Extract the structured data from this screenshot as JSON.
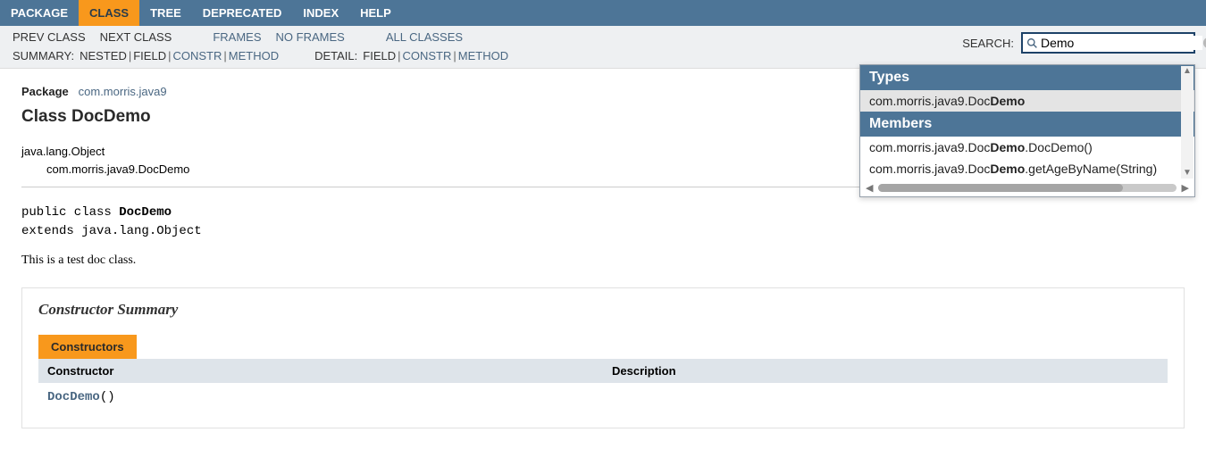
{
  "topNav": {
    "items": [
      {
        "label": "PACKAGE"
      },
      {
        "label": "CLASS"
      },
      {
        "label": "TREE"
      },
      {
        "label": "DEPRECATED"
      },
      {
        "label": "INDEX"
      },
      {
        "label": "HELP"
      }
    ],
    "activeIndex": 1
  },
  "subNav": {
    "prev": "PREV CLASS",
    "next": "NEXT CLASS",
    "frames": "FRAMES",
    "noFrames": "NO FRAMES",
    "allClasses": "ALL CLASSES",
    "summaryLabel": "SUMMARY:",
    "summary": {
      "nested": "NESTED",
      "field": "FIELD",
      "constr": "CONSTR",
      "method": "METHOD"
    },
    "detailLabel": "DETAIL:",
    "detail": {
      "field": "FIELD",
      "constr": "CONSTR",
      "method": "METHOD"
    }
  },
  "search": {
    "label": "SEARCH:",
    "value": "Demo",
    "placeholder": ""
  },
  "dropdown": {
    "typesHeader": "Types",
    "typeItem": {
      "prefix": "com.morris.java9.Doc",
      "bold": "Demo"
    },
    "membersHeader": "Members",
    "memberItems": [
      {
        "prefix": "com.morris.java9.Doc",
        "bold": "Demo",
        "suffix": ".DocDemo()"
      },
      {
        "prefix": "com.morris.java9.Doc",
        "bold": "Demo",
        "suffix": ".getAgeByName(String)"
      }
    ]
  },
  "page": {
    "packageLabel": "Package",
    "packageLink": "com.morris.java9",
    "classTitle": "Class DocDemo",
    "inherit1": "java.lang.Object",
    "inherit2": "com.morris.java9.DocDemo",
    "sigLine1Prefix": "public class ",
    "sigLine1Class": "DocDemo",
    "sigLine2": "extends java.lang.Object",
    "description": "This is a test doc class.",
    "constructorSummary": "Constructor Summary",
    "constructorsTab": "Constructors",
    "thConstructor": "Constructor",
    "thDescription": "Description",
    "ctorName": "DocDemo",
    "ctorParens": "()"
  }
}
